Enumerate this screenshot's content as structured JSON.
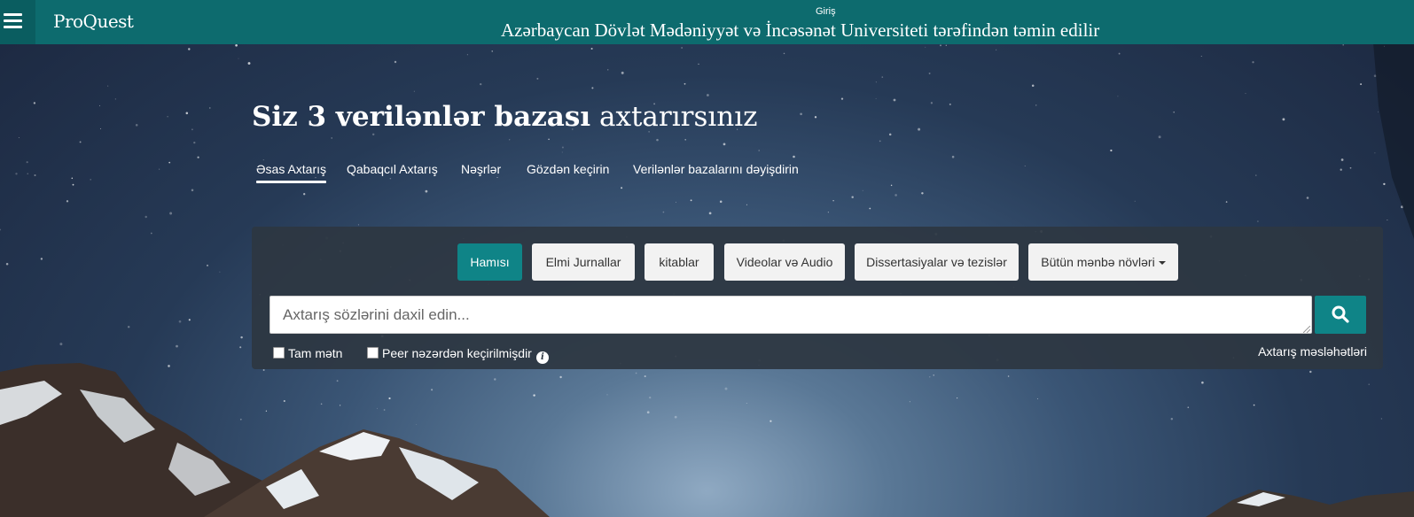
{
  "header": {
    "logo": "ProQuest",
    "login": "Giriş",
    "institution": "Azərbaycan Dövlət Mədəniyyət və İncəsənət Universiteti tərəfindən təmin edilir",
    "brand_color": "#0d6b6e"
  },
  "title": {
    "bold": "Siz 3 verilənlər bazası",
    "regular": "axtarırsınız"
  },
  "tabs": [
    {
      "label": "Əsas Axtarış",
      "active": true
    },
    {
      "label": "Qabaqcıl Axtarış"
    },
    {
      "label": "Nəşrlər"
    },
    {
      "label": "Gözdən keçirin"
    },
    {
      "label": "Verilənlər bazalarını dəyişdirin"
    }
  ],
  "source_types": [
    {
      "label": "Hamısı",
      "active": true
    },
    {
      "label": "Elmi Jurnallar"
    },
    {
      "label": "kitablar"
    },
    {
      "label": "Videolar və Audio"
    },
    {
      "label": "Dissertasiyalar və tezislər"
    },
    {
      "label": "Bütün mənbə növləri"
    }
  ],
  "search": {
    "placeholder": "Axtarış sözlərini daxil edin...",
    "value": ""
  },
  "filters": {
    "full_text": "Tam mətn",
    "peer_reviewed": "Peer nəzərdən keçirilmişdir"
  },
  "tips": "Axtarış məsləhətləri",
  "icons": {
    "menu": "hamburger-icon",
    "search": "magnifier-icon",
    "info": "info-icon"
  },
  "accent_color": "#0f8487"
}
